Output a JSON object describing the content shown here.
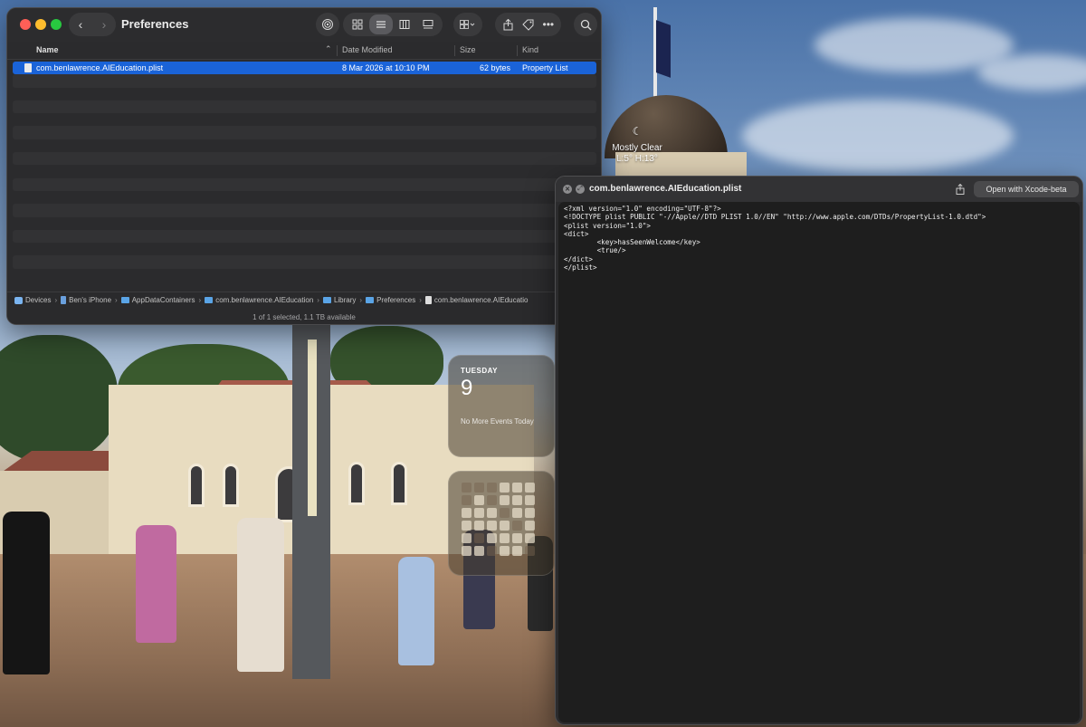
{
  "finder": {
    "title": "Preferences",
    "columns": {
      "name": "Name",
      "date": "Date Modified",
      "size": "Size",
      "kind": "Kind"
    },
    "files": [
      {
        "name": "com.benlawrence.AIEducation.plist",
        "date": "8 Mar 2026 at 10:10 PM",
        "size": "62 bytes",
        "kind": "Property List"
      }
    ],
    "path": [
      "Devices",
      "Ben's iPhone",
      "AppDataContainers",
      "com.benlawrence.AIEducation",
      "Library",
      "Preferences",
      "com.benlawrence.AIEducatio"
    ],
    "status": "1 of 1 selected, 1.1 TB available",
    "icons": {
      "back": "chevron-left-icon",
      "forward": "chevron-right-icon",
      "airdrop": "airdrop-icon",
      "icon_view": "icon-grid-view-icon",
      "list_view": "list-view-icon",
      "column_view": "column-view-icon",
      "gallery_view": "gallery-view-icon",
      "group": "group-by-icon",
      "share": "share-icon",
      "tag": "tag-icon",
      "more": "ellipsis-icon",
      "search": "search-icon"
    }
  },
  "quicklook": {
    "title": "com.benlawrence.AIEducation.plist",
    "open_button": "Open with Xcode-beta",
    "content": "<?xml version=\"1.0\" encoding=\"UTF-8\"?>\n<!DOCTYPE plist PUBLIC \"-//Apple//DTD PLIST 1.0//EN\" \"http://www.apple.com/DTDs/PropertyList-1.0.dtd\">\n<plist version=\"1.0\">\n<dict>\n        <key>hasSeenWelcome</key>\n        <true/>\n</dict>\n</plist>"
  },
  "widgets": {
    "weather": {
      "condition": "Mostly Clear",
      "range": "L:5° H:13°"
    },
    "calendar": {
      "day": "TUESDAY",
      "date": "9",
      "events": "No More Events Today"
    }
  },
  "colors": {
    "selection": "#1a63d8",
    "window_bg": "#2b2b2d",
    "close": "#ff5f57",
    "minimize": "#febc2e",
    "maximize": "#28c840"
  }
}
